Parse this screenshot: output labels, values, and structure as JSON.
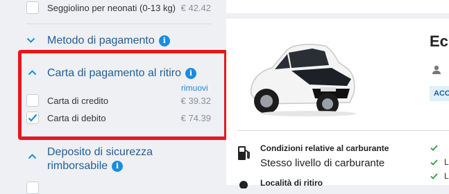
{
  "extras": {
    "child_seat": {
      "label": "Seggiolino per neonati (0-13 kg)",
      "price": "€ 42.42",
      "checked": false
    }
  },
  "payment_method": {
    "title": "Metodo di pagamento",
    "info": "i"
  },
  "pickup_payment_card": {
    "title": "Carta di pagamento al ritiro",
    "info": "i",
    "remove_link": "rimuovi",
    "options": [
      {
        "label": "Carta di credito",
        "price": "€ 39.32",
        "checked": false
      },
      {
        "label": "Carta di debito",
        "price": "€ 74.39",
        "checked": true
      }
    ]
  },
  "deposit": {
    "title_line1": "Deposito di sicurezza",
    "title_line2": "rimborsabile",
    "info": "i"
  },
  "car_card": {
    "title": "Ec",
    "tag": "ACC",
    "fuel_policy_label": "Condizioni relative al carburante",
    "fuel_policy_value": "Stesso livello di carburante",
    "pickup_location_label": "Località di ritiro",
    "features": [
      "",
      "L",
      "L"
    ]
  },
  "colors": {
    "accent": "#1a8ce0",
    "highlight": "#e8161b",
    "check": "#2e9b3d"
  }
}
